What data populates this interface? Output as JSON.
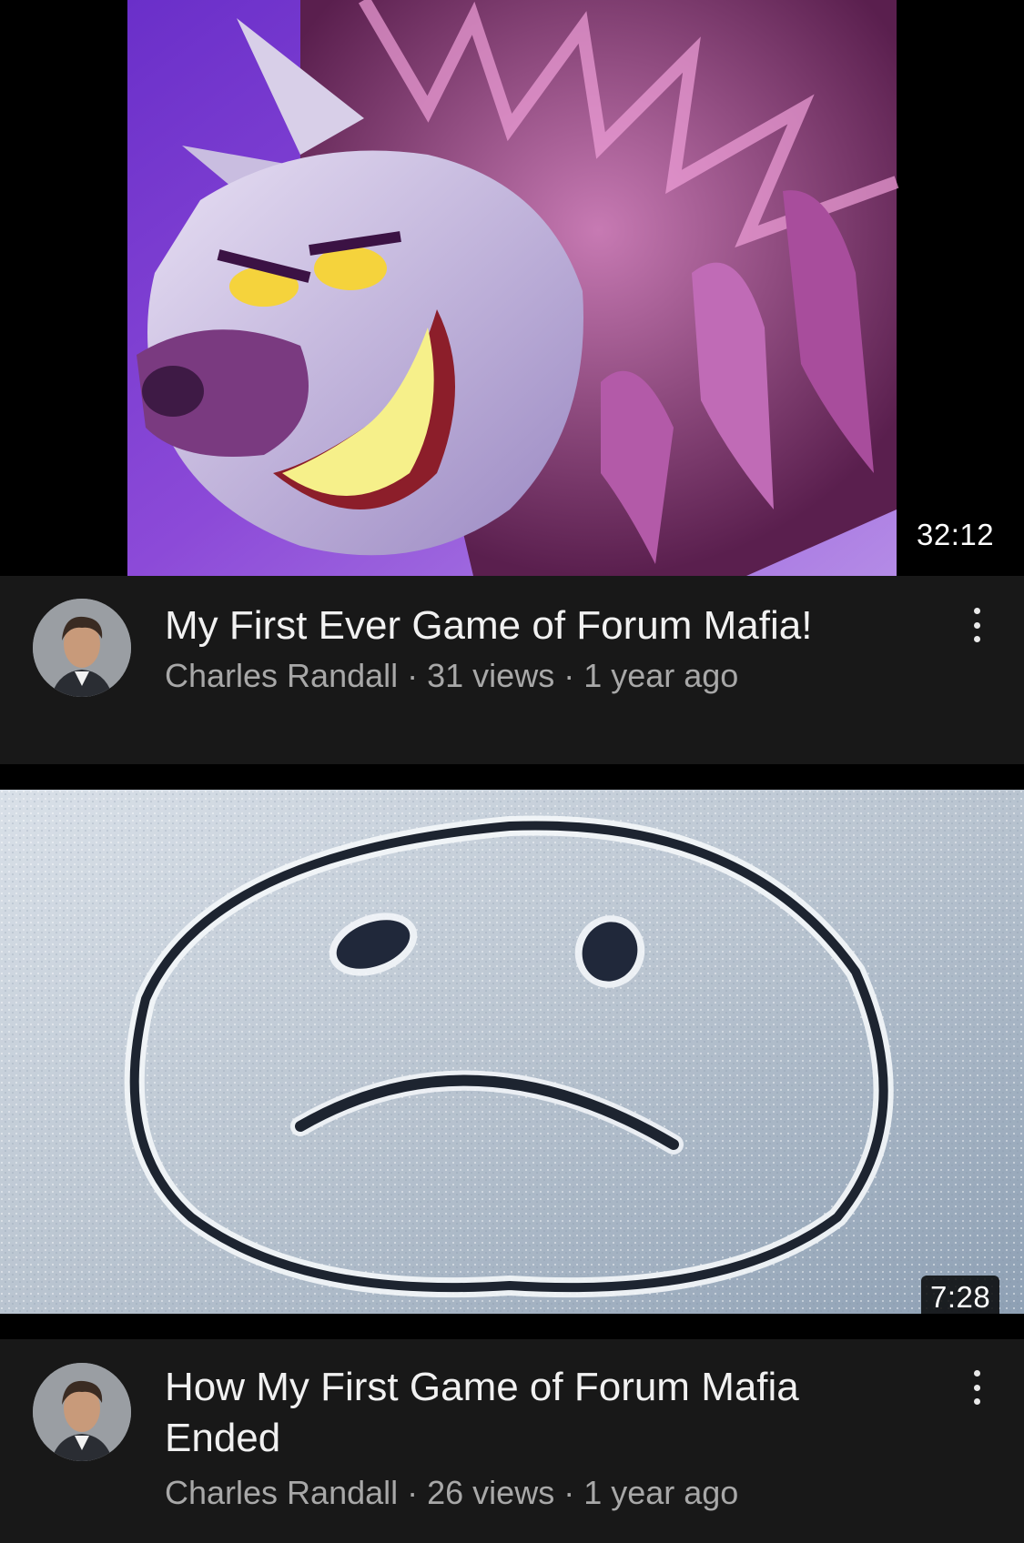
{
  "videos": [
    {
      "thumbnail_icon": "purple-wolf-monster-thumbnail",
      "duration": "32:12",
      "title": "My First Ever Game of Forum Mafia!",
      "channel": "Charles Randall",
      "views": "31 views",
      "age": "1 year ago",
      "separator": " · "
    },
    {
      "thumbnail_icon": "sad-face-in-snow-thumbnail",
      "duration": "7:28",
      "title": "How My First Game of Forum Mafia Ended",
      "channel": "Charles Randall",
      "views": "26 views",
      "age": "1 year ago",
      "separator": " · "
    }
  ],
  "colors": {
    "background": "#000000",
    "card_background": "#181818",
    "title_text": "#f1f1f1",
    "meta_text": "#a8a8a8"
  }
}
